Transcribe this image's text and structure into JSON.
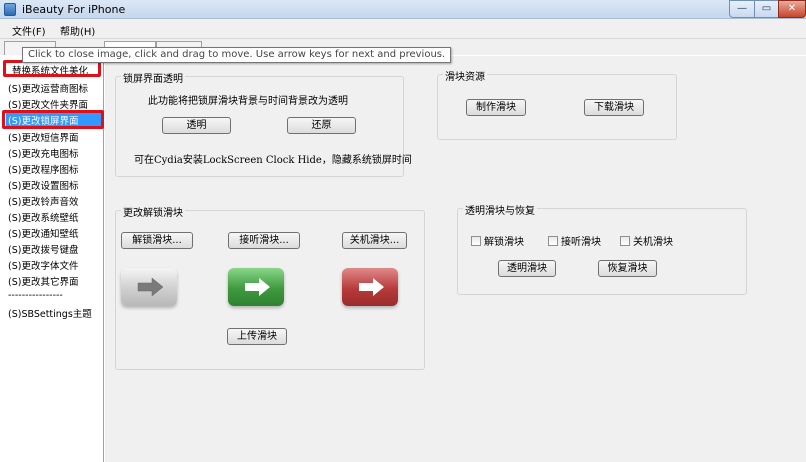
{
  "window": {
    "title": "iBeauty For iPhone",
    "buttons": {
      "minimize": "—",
      "maximize": "▭",
      "close": "✕"
    }
  },
  "menu": {
    "file": "文件(F)",
    "help": "帮助(H)"
  },
  "tabs": [
    "",
    "",
    ""
  ],
  "tooltip": "Click to close image, click and drag to move. Use arrow keys for next and previous.",
  "sidebar": {
    "items": [
      {
        "label": "替换系统文件美化",
        "selected": false
      },
      {
        "label": "(S)更改运营商图标",
        "selected": false
      },
      {
        "label": "(S)更改文件夹界面",
        "selected": false
      },
      {
        "label": "(S)更改锁屏界面",
        "selected": true
      },
      {
        "label": "(S)更改短信界面",
        "selected": false
      },
      {
        "label": "(S)更改充电图标",
        "selected": false
      },
      {
        "label": "(S)更改程序图标",
        "selected": false
      },
      {
        "label": "(S)更改设置图标",
        "selected": false
      },
      {
        "label": "(S)更改铃声音效",
        "selected": false
      },
      {
        "label": "(S)更改系统壁纸",
        "selected": false
      },
      {
        "label": "(S)更改通知壁纸",
        "selected": false
      },
      {
        "label": "(S)更改拨号键盘",
        "selected": false
      },
      {
        "label": "(S)更改字体文件",
        "selected": false
      },
      {
        "label": "(S)更改其它界面",
        "selected": false
      },
      {
        "label": "----------------",
        "selected": false
      },
      {
        "label": "(S)SBSettings主题",
        "selected": false
      }
    ]
  },
  "lock_transparency": {
    "title": "锁屏界面透明",
    "description": "此功能将把锁屏滑块背景与时间背景改为透明",
    "transparent_button": "透明",
    "restore_button": "还原",
    "note": "可在Cydia安装LockScreen Clock Hide，隐藏系统锁屏时间"
  },
  "slider_resources": {
    "title": "滑块资源",
    "make_button": "制作滑块",
    "download_button": "下载滑块"
  },
  "change_slider": {
    "title": "更改解锁滑块",
    "unlock_button": "解锁滑块...",
    "answer_button": "接听滑块...",
    "shutdown_button": "关机滑块...",
    "upload_button": "上传滑块",
    "arrow_icons": [
      "arrow-right-gray-icon",
      "arrow-right-green-icon",
      "arrow-right-red-icon"
    ],
    "colors": {
      "gray": "#c8c8c8",
      "green": "#3e9a3e",
      "red": "#b83a3a"
    }
  },
  "transparent_restore": {
    "title": "透明滑块与恢复",
    "checkbox_unlock": "解锁滑块",
    "checkbox_answer": "接听滑块",
    "checkbox_shutdown": "关机滑块",
    "transparent_button": "透明滑块",
    "restore_button": "恢复滑块"
  },
  "highlight_color": "#e0101a"
}
